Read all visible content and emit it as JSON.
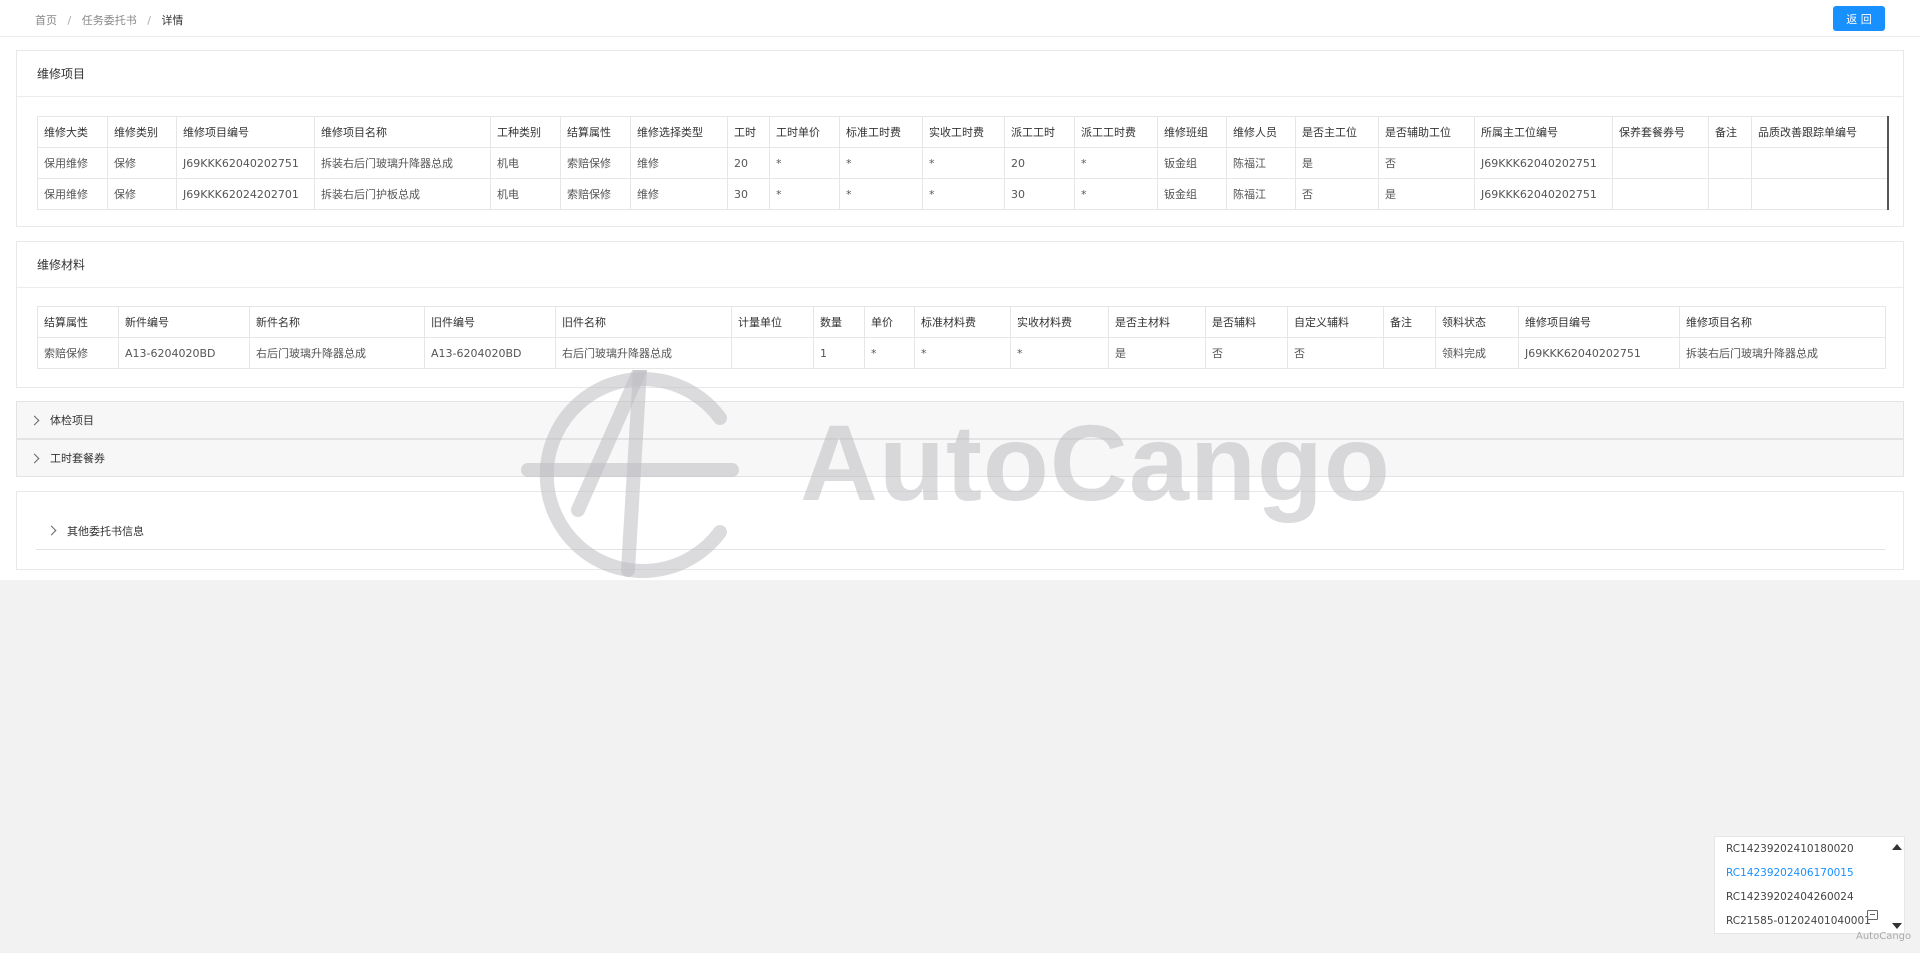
{
  "breadcrumb": {
    "home": "首页",
    "parent": "任务委托书",
    "current": "详情",
    "sep": "/"
  },
  "back_button": "返 回",
  "repair_items": {
    "title": "维修项目",
    "headers": [
      "维修大类",
      "维修类别",
      "维修项目编号",
      "维修项目名称",
      "工种类别",
      "结算属性",
      "维修选择类型",
      "工时",
      "工时单价",
      "标准工时费",
      "实收工时费",
      "派工工时",
      "派工工时费",
      "维修班组",
      "维修人员",
      "是否主工位",
      "是否辅助工位",
      "所属主工位编号",
      "保养套餐券号",
      "备注",
      "品质改善跟踪单编号"
    ],
    "rows": [
      [
        "保用维修",
        "保修",
        "J69KKK62040202751",
        "拆装右后门玻璃升降器总成",
        "机电",
        "索赔保修",
        "维修",
        "20",
        "*",
        "*",
        "*",
        "20",
        "*",
        "钣金组",
        "陈福江",
        "是",
        "否",
        "J69KKK62040202751",
        "",
        "",
        ""
      ],
      [
        "保用维修",
        "保修",
        "J69KKK62024202701",
        "拆装右后门护板总成",
        "机电",
        "索赔保修",
        "维修",
        "30",
        "*",
        "*",
        "*",
        "30",
        "*",
        "钣金组",
        "陈福江",
        "否",
        "是",
        "J69KKK62040202751",
        "",
        "",
        ""
      ]
    ]
  },
  "repair_materials": {
    "title": "维修材料",
    "headers": [
      "结算属性",
      "新件编号",
      "新件名称",
      "旧件编号",
      "旧件名称",
      "计量单位",
      "数量",
      "单价",
      "标准材料费",
      "实收材料费",
      "是否主材料",
      "是否辅料",
      "自定义辅料",
      "备注",
      "领料状态",
      "维修项目编号",
      "维修项目名称"
    ],
    "rows": [
      [
        "索赔保修",
        "A13-6204020BD",
        "右后门玻璃升降器总成",
        "A13-6204020BD",
        "右后门玻璃升降器总成",
        "",
        "1",
        "*",
        "*",
        "*",
        "是",
        "否",
        "否",
        "",
        "领料完成",
        "J69KKK62040202751",
        "拆装右后门玻璃升降器总成"
      ]
    ]
  },
  "collapsed_sections": [
    "体检项目",
    "工时套餐券"
  ],
  "other_info": "其他委托书信息",
  "watermark": "AutoCango",
  "order_list": {
    "items": [
      "RC14239202410180020",
      "RC14239202406170015",
      "RC14239202404260024",
      "RC21585-01202401040001"
    ],
    "active_index": 1
  },
  "brand_small": "AutoCango"
}
